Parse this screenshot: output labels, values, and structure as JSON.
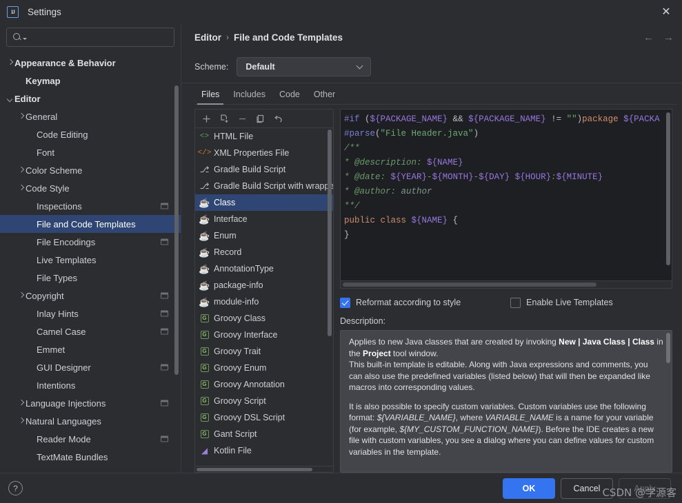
{
  "window": {
    "title": "Settings",
    "logo_text": "IJ",
    "close_icon": "✕"
  },
  "sidebar": {
    "search": {
      "value": "",
      "placeholder": ""
    },
    "items": [
      {
        "label": "Appearance & Behavior",
        "indent": 0,
        "twisty": "right",
        "bold": true,
        "selected": false,
        "badge": false
      },
      {
        "label": "Keymap",
        "indent": 1,
        "twisty": "none",
        "bold": true,
        "selected": false,
        "badge": false
      },
      {
        "label": "Editor",
        "indent": 0,
        "twisty": "down",
        "bold": true,
        "selected": false,
        "badge": false
      },
      {
        "label": "General",
        "indent": 1,
        "twisty": "right",
        "bold": false,
        "selected": false,
        "badge": false
      },
      {
        "label": "Code Editing",
        "indent": 2,
        "twisty": "none",
        "bold": false,
        "selected": false,
        "badge": false
      },
      {
        "label": "Font",
        "indent": 2,
        "twisty": "none",
        "bold": false,
        "selected": false,
        "badge": false
      },
      {
        "label": "Color Scheme",
        "indent": 1,
        "twisty": "right",
        "bold": false,
        "selected": false,
        "badge": false
      },
      {
        "label": "Code Style",
        "indent": 1,
        "twisty": "right",
        "bold": false,
        "selected": false,
        "badge": false
      },
      {
        "label": "Inspections",
        "indent": 2,
        "twisty": "none",
        "bold": false,
        "selected": false,
        "badge": true
      },
      {
        "label": "File and Code Templates",
        "indent": 2,
        "twisty": "none",
        "bold": false,
        "selected": true,
        "badge": false
      },
      {
        "label": "File Encodings",
        "indent": 2,
        "twisty": "none",
        "bold": false,
        "selected": false,
        "badge": true
      },
      {
        "label": "Live Templates",
        "indent": 2,
        "twisty": "none",
        "bold": false,
        "selected": false,
        "badge": false
      },
      {
        "label": "File Types",
        "indent": 2,
        "twisty": "none",
        "bold": false,
        "selected": false,
        "badge": false
      },
      {
        "label": "Copyright",
        "indent": 1,
        "twisty": "right",
        "bold": false,
        "selected": false,
        "badge": true
      },
      {
        "label": "Inlay Hints",
        "indent": 2,
        "twisty": "none",
        "bold": false,
        "selected": false,
        "badge": true
      },
      {
        "label": "Camel Case",
        "indent": 2,
        "twisty": "none",
        "bold": false,
        "selected": false,
        "badge": true
      },
      {
        "label": "Emmet",
        "indent": 2,
        "twisty": "none",
        "bold": false,
        "selected": false,
        "badge": false
      },
      {
        "label": "GUI Designer",
        "indent": 2,
        "twisty": "none",
        "bold": false,
        "selected": false,
        "badge": true
      },
      {
        "label": "Intentions",
        "indent": 2,
        "twisty": "none",
        "bold": false,
        "selected": false,
        "badge": false
      },
      {
        "label": "Language Injections",
        "indent": 1,
        "twisty": "right",
        "bold": false,
        "selected": false,
        "badge": true
      },
      {
        "label": "Natural Languages",
        "indent": 1,
        "twisty": "right",
        "bold": false,
        "selected": false,
        "badge": false
      },
      {
        "label": "Reader Mode",
        "indent": 2,
        "twisty": "none",
        "bold": false,
        "selected": false,
        "badge": true
      },
      {
        "label": "TextMate Bundles",
        "indent": 2,
        "twisty": "none",
        "bold": false,
        "selected": false,
        "badge": false
      }
    ]
  },
  "breadcrumb": {
    "root": "Editor",
    "separator": "›",
    "current": "File and Code Templates",
    "back_icon": "←",
    "forward_icon": "→"
  },
  "scheme": {
    "label": "Scheme:",
    "value": "Default"
  },
  "tabs": [
    {
      "label": "Files",
      "active": true
    },
    {
      "label": "Includes",
      "active": false
    },
    {
      "label": "Code",
      "active": false
    },
    {
      "label": "Other",
      "active": false
    }
  ],
  "list_toolbar": [
    {
      "name": "add-template-button",
      "icon": "plus"
    },
    {
      "name": "copy-template-button",
      "icon": "copy-add"
    },
    {
      "name": "remove-template-button",
      "icon": "minus"
    },
    {
      "name": "duplicate-template-button",
      "icon": "duplicate"
    },
    {
      "name": "reset-template-button",
      "icon": "undo"
    }
  ],
  "templates": [
    {
      "label": "HTML File",
      "icon": "html-icon",
      "kind": "html",
      "glyph": "<>",
      "selected": false
    },
    {
      "label": "XML Properties File",
      "icon": "xml-icon",
      "kind": "xml",
      "glyph": "</>",
      "selected": false
    },
    {
      "label": "Gradle Build Script",
      "icon": "gradle-icon",
      "kind": "gradle",
      "glyph": "⎇",
      "selected": false
    },
    {
      "label": "Gradle Build Script with wrapper",
      "icon": "gradle-icon",
      "kind": "gradle",
      "glyph": "⎇",
      "selected": false
    },
    {
      "label": "Class",
      "icon": "java-icon",
      "kind": "java",
      "glyph": "☕",
      "selected": true
    },
    {
      "label": "Interface",
      "icon": "java-icon",
      "kind": "java",
      "glyph": "☕",
      "selected": false
    },
    {
      "label": "Enum",
      "icon": "java-icon",
      "kind": "java",
      "glyph": "☕",
      "selected": false
    },
    {
      "label": "Record",
      "icon": "java-icon",
      "kind": "java",
      "glyph": "☕",
      "selected": false
    },
    {
      "label": "AnnotationType",
      "icon": "java-icon",
      "kind": "java",
      "glyph": "☕",
      "selected": false
    },
    {
      "label": "package-info",
      "icon": "java-icon",
      "kind": "java",
      "glyph": "☕",
      "selected": false
    },
    {
      "label": "module-info",
      "icon": "java-icon",
      "kind": "java",
      "glyph": "☕",
      "selected": false
    },
    {
      "label": "Groovy Class",
      "icon": "groovy-icon",
      "kind": "groovy",
      "glyph": "G",
      "selected": false
    },
    {
      "label": "Groovy Interface",
      "icon": "groovy-icon",
      "kind": "groovy",
      "glyph": "G",
      "selected": false
    },
    {
      "label": "Groovy Trait",
      "icon": "groovy-icon",
      "kind": "groovy",
      "glyph": "G",
      "selected": false
    },
    {
      "label": "Groovy Enum",
      "icon": "groovy-icon",
      "kind": "groovy",
      "glyph": "G",
      "selected": false
    },
    {
      "label": "Groovy Annotation",
      "icon": "groovy-icon",
      "kind": "groovy",
      "glyph": "G",
      "selected": false
    },
    {
      "label": "Groovy Script",
      "icon": "groovy-icon",
      "kind": "groovy",
      "glyph": "G",
      "selected": false
    },
    {
      "label": "Groovy DSL Script",
      "icon": "groovy-icon",
      "kind": "groovy",
      "glyph": "G",
      "selected": false
    },
    {
      "label": "Gant Script",
      "icon": "groovy-icon",
      "kind": "groovy",
      "glyph": "G",
      "selected": false
    },
    {
      "label": "Kotlin File",
      "icon": "kotlin-icon",
      "kind": "kotlin",
      "glyph": "◢",
      "selected": false
    }
  ],
  "editor": {
    "lines": [
      [
        {
          "t": "#if ",
          "c": "k-dir"
        },
        {
          "t": "(",
          "c": "k-op"
        },
        {
          "t": "${PACKAGE_NAME}",
          "c": "k-var"
        },
        {
          "t": " && ",
          "c": "k-op"
        },
        {
          "t": "${PACKAGE_NAME}",
          "c": "k-var"
        },
        {
          "t": " != ",
          "c": "k-op"
        },
        {
          "t": "\"\"",
          "c": "k-str"
        },
        {
          "t": ")",
          "c": "k-op"
        },
        {
          "t": "package ",
          "c": "k-kw"
        },
        {
          "t": "${PACKA",
          "c": "k-var"
        }
      ],
      [
        {
          "t": "#parse",
          "c": "k-dir"
        },
        {
          "t": "(",
          "c": "k-op"
        },
        {
          "t": "\"File Header.java\"",
          "c": "k-str"
        },
        {
          "t": ")",
          "c": "k-op"
        }
      ],
      [
        {
          "t": "/**",
          "c": "k-cmt"
        }
      ],
      [
        {
          "t": "* ",
          "c": "k-cmt"
        },
        {
          "t": "@description: ",
          "c": "k-cmt"
        },
        {
          "t": "${NAME}",
          "c": "k-var"
        }
      ],
      [
        {
          "t": "* ",
          "c": "k-cmt"
        },
        {
          "t": "@date: ",
          "c": "k-cmt"
        },
        {
          "t": "${YEAR}",
          "c": "k-var"
        },
        {
          "t": "-",
          "c": "k-cmt"
        },
        {
          "t": "${MONTH}",
          "c": "k-var"
        },
        {
          "t": "-",
          "c": "k-cmt"
        },
        {
          "t": "${DAY}",
          "c": "k-var"
        },
        {
          "t": " ",
          "c": "k-cmt"
        },
        {
          "t": "${HOUR}",
          "c": "k-var"
        },
        {
          "t": ":",
          "c": "k-cmt"
        },
        {
          "t": "${MINUTE}",
          "c": "k-var"
        }
      ],
      [
        {
          "t": "* ",
          "c": "k-cmt"
        },
        {
          "t": "@author: ",
          "c": "k-cmt"
        },
        {
          "t": "author",
          "c": "k-cmt2"
        }
      ],
      [
        {
          "t": "**/",
          "c": "k-cmt"
        }
      ],
      [
        {
          "t": "public class ",
          "c": "k-kw"
        },
        {
          "t": "${NAME}",
          "c": "k-var"
        },
        {
          "t": " {",
          "c": "k-plain"
        }
      ],
      [
        {
          "t": "}",
          "c": "k-plain"
        }
      ]
    ]
  },
  "options": {
    "reformat": {
      "label": "Reformat according to style",
      "checked": true
    },
    "live_templates": {
      "label": "Enable Live Templates",
      "checked": false
    }
  },
  "description": {
    "label": "Description:",
    "paragraph1_a": "Applies to new Java classes that are created by invoking ",
    "paragraph1_b": "New | Java Class | Class",
    "paragraph1_c": " in the ",
    "paragraph1_d": "Project",
    "paragraph1_e": " tool window.",
    "paragraph2": "This built-in template is editable. Along with Java expressions and comments, you can also use the predefined variables (listed below) that will then be expanded like macros into corresponding values.",
    "paragraph3_a": "It is also possible to specify custom variables. Custom variables use the following format: ",
    "paragraph3_b": "${VARIABLE_NAME}",
    "paragraph3_c": ", where ",
    "paragraph3_d": "VARIABLE_NAME",
    "paragraph3_e": " is a name for your variable (for example, ",
    "paragraph3_f": "${MY_CUSTOM_FUNCTION_NAME}",
    "paragraph3_g": "). Before the IDE creates a new file with custom variables, you see a dialog where you can define values for custom variables in the template."
  },
  "footer": {
    "help_icon": "?",
    "ok": "OK",
    "cancel": "Cancel",
    "apply": "Apply"
  },
  "watermark": "CSDN @学源客",
  "colors": {
    "accent": "#3574f0",
    "selection": "#2f4675",
    "background": "#2b2d30",
    "editor_bg": "#1e1f22",
    "description_bg": "#43454a"
  }
}
